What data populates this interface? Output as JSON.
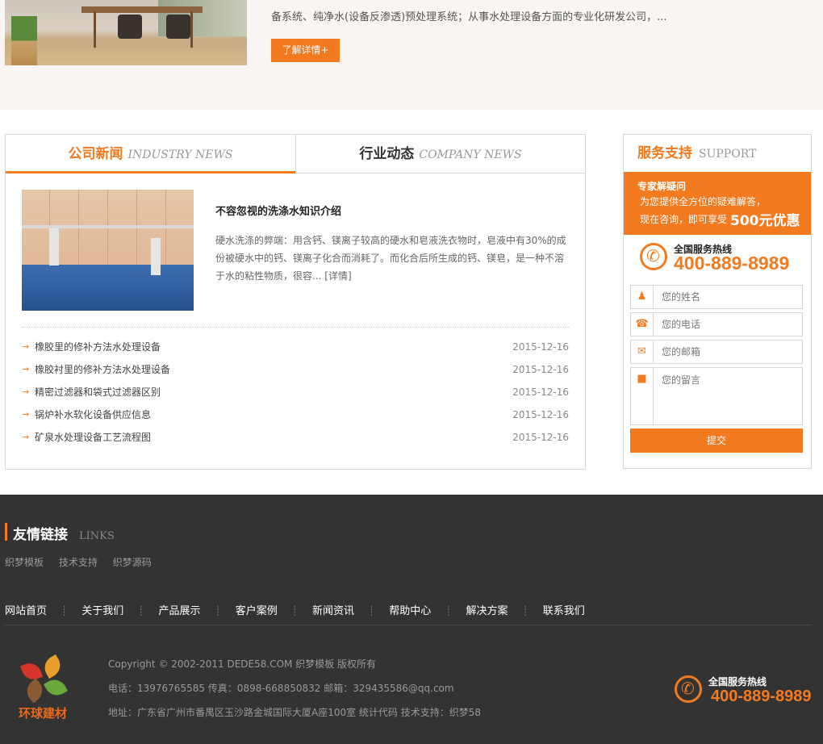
{
  "about": {
    "text": "备系统、纯净水(设备反渗透)预处理系统；从事水处理设备方面的专业化研发公司，...",
    "more_label": "了解详情+"
  },
  "news": {
    "tabs": [
      {
        "cn": "公司新闻",
        "en": "INDUSTRY NEWS",
        "active": true
      },
      {
        "cn": "行业动态",
        "en": "COMPANY NEWS",
        "active": false
      }
    ],
    "featured": {
      "title": "不容忽视的洗涤水知识介绍",
      "desc": "硬水洗涤的弊端：用含钙、镁离子较高的硬水和皂液洗衣物时，皂液中有30%的成份被硬水中的钙、镁离子化合而消耗了。而化合后所生成的钙、镁皂，是一种不溶于水的粘性物质，很容... ",
      "more": "[详情]"
    },
    "items": [
      {
        "title": "橡胶里的修补方法水处理设备",
        "date": "2015-12-16"
      },
      {
        "title": "橡胶衬里的修补方法水处理设备",
        "date": "2015-12-16"
      },
      {
        "title": "精密过滤器和袋式过滤器区别",
        "date": "2015-12-16"
      },
      {
        "title": "锅炉补水软化设备供应信息",
        "date": "2015-12-16"
      },
      {
        "title": "矿泉水处理设备工艺流程图",
        "date": "2015-12-16"
      }
    ]
  },
  "support": {
    "title_cn": "服务支持",
    "title_en": "SUPPORT",
    "banner_title": "专家解疑问",
    "banner_line1": "为您提供全方位的疑难解答，",
    "banner_line2": "现在咨询，即可享受",
    "banner_offer": "500元优惠",
    "hotline_label": "全国服务热线",
    "hotline": "400-889-8989",
    "name_ph": "您的姓名",
    "phone_ph": "您的电话",
    "email_ph": "您的邮箱",
    "msg_ph": "您的留言",
    "submit": "提交"
  },
  "footer": {
    "links_cn": "友情链接",
    "links_en": "LINKS",
    "friend_links": [
      "织梦模板",
      "技术支持",
      "织梦源码"
    ],
    "nav": [
      "网站首页",
      "关于我们",
      "产品展示",
      "客户案例",
      "新闻资讯",
      "帮助中心",
      "解决方案",
      "联系我们"
    ],
    "logo_text": "环球建材",
    "copyright": "Copyright © 2002-2011 DEDE58.COM 织梦模板 版权所有",
    "contact": "电话：13976765585 传真：0898-668850832 邮箱：329435586@qq.com",
    "address": "地址：广东省广州市番禺区玉沙路金城国际大厦A座100室 统计代码 技术支持：织梦58",
    "hotline_label": "全国服务热线",
    "hotline": "400-889-8989"
  }
}
